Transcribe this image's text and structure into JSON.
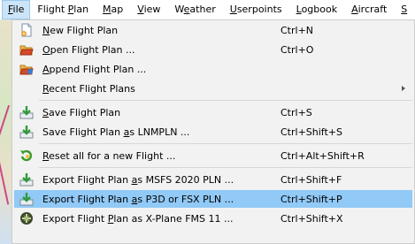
{
  "menubar": {
    "items": [
      {
        "pre": "",
        "m": "F",
        "post": "ile"
      },
      {
        "pre": "Flight ",
        "m": "P",
        "post": "lan"
      },
      {
        "pre": "",
        "m": "M",
        "post": "ap"
      },
      {
        "pre": "",
        "m": "V",
        "post": "iew"
      },
      {
        "pre": "W",
        "m": "e",
        "post": "ather"
      },
      {
        "pre": "",
        "m": "U",
        "post": "serpoints"
      },
      {
        "pre": "",
        "m": "L",
        "post": "ogbook"
      },
      {
        "pre": "",
        "m": "A",
        "post": "ircraft"
      },
      {
        "pre": "",
        "m": "S",
        "post": ""
      }
    ]
  },
  "file_menu": {
    "items": [
      {
        "pre": "",
        "m": "N",
        "post": "ew Flight Plan",
        "shortcut": "Ctrl+N",
        "icon": "new-plan-icon"
      },
      {
        "pre": "",
        "m": "O",
        "post": "pen Flight Plan ...",
        "shortcut": "Ctrl+O",
        "icon": "folder-open-icon"
      },
      {
        "pre": "",
        "m": "A",
        "post": "ppend Flight Plan ...",
        "shortcut": "",
        "icon": "append-plan-icon"
      },
      {
        "pre": "",
        "m": "R",
        "post": "ecent Flight Plans",
        "shortcut": "",
        "icon": ""
      },
      {
        "pre": "",
        "m": "S",
        "post": "ave Flight Plan",
        "shortcut": "Ctrl+S",
        "icon": "save-icon"
      },
      {
        "pre": "Save Flight Plan ",
        "m": "a",
        "post": "s LNMPLN ...",
        "shortcut": "Ctrl+Shift+S",
        "icon": "save-as-icon"
      },
      {
        "pre": "",
        "m": "R",
        "post": "eset all for a new Flight ...",
        "shortcut": "Ctrl+Alt+Shift+R",
        "icon": "reset-icon"
      },
      {
        "pre": "Export Flight Plan ",
        "m": "a",
        "post": "s MSFS 2020 PLN ...",
        "shortcut": "Ctrl+Shift+F",
        "icon": "export-icon"
      },
      {
        "pre": "Export Flight Plan ",
        "m": "a",
        "post": "s P3D or FSX  PLN ...",
        "shortcut": "Ctrl+Shift+P",
        "icon": "export-icon"
      },
      {
        "pre": "Export Flight ",
        "m": "P",
        "post": "lan as X-Plane FMS 11 ...",
        "shortcut": "Ctrl+Shift+X",
        "icon": "xplane-icon"
      }
    ]
  },
  "colors": {
    "highlight": "#91c9f7",
    "menu_bg": "#f2f2f2",
    "menubar_active": "#cce4f7"
  }
}
